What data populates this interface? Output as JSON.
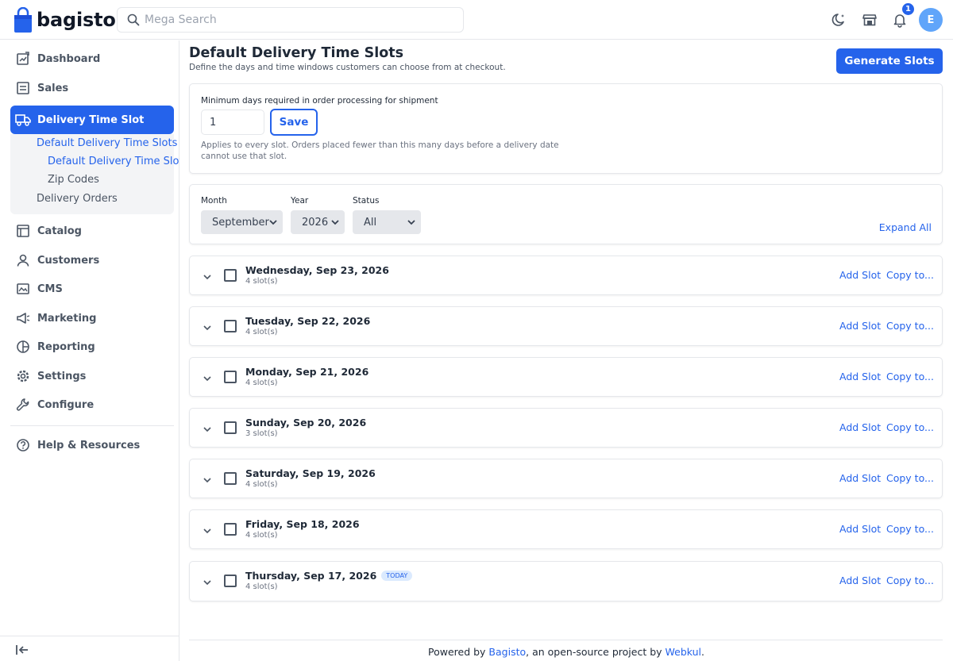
{
  "header": {
    "logo_text": "bagisto",
    "search_placeholder": "Mega Search",
    "notification_count": "1",
    "avatar_initial": "E"
  },
  "sidebar": {
    "items": [
      {
        "label": "Dashboard",
        "icon": "dashboard-icon"
      },
      {
        "label": "Sales",
        "icon": "sales-icon"
      },
      {
        "label": "Delivery Time Slot",
        "icon": "delivery-truck-icon",
        "active": true
      },
      {
        "label": "Catalog",
        "icon": "catalog-icon"
      },
      {
        "label": "Customers",
        "icon": "customers-icon"
      },
      {
        "label": "CMS",
        "icon": "cms-icon"
      },
      {
        "label": "Marketing",
        "icon": "marketing-icon"
      },
      {
        "label": "Reporting",
        "icon": "reporting-icon"
      },
      {
        "label": "Settings",
        "icon": "gear-icon"
      },
      {
        "label": "Configure",
        "icon": "wrench-icon"
      },
      {
        "label": "Help & Resources",
        "icon": "help-icon"
      }
    ],
    "sub_items": [
      {
        "label": "Default Delivery Time Slots",
        "active": true
      },
      {
        "label": "Default Delivery Time Slots",
        "active": true
      },
      {
        "label": "Zip Codes",
        "active": false
      },
      {
        "label": "Delivery Orders",
        "active": false
      }
    ]
  },
  "page": {
    "title": "Default Delivery Time Slots",
    "description": "Define the days and time windows customers can choose from at checkout.",
    "generate_label": "Generate Slots"
  },
  "min_days": {
    "label": "Minimum days required in order processing for shipment",
    "value": "1",
    "save_label": "Save",
    "help": "Applies to every slot. Orders placed fewer than this many days before a delivery date cannot use that slot."
  },
  "filters": {
    "month_label": "Month",
    "month_value": "September",
    "year_label": "Year",
    "year_value": "2026",
    "status_label": "Status",
    "status_value": "All",
    "expand_all": "Expand All"
  },
  "days": [
    {
      "title": "Wednesday, Sep 23, 2026",
      "count": "4 slot(s)"
    },
    {
      "title": "Tuesday, Sep 22, 2026",
      "count": "4 slot(s)"
    },
    {
      "title": "Monday, Sep 21, 2026",
      "count": "4 slot(s)"
    },
    {
      "title": "Sunday, Sep 20, 2026",
      "count": "3 slot(s)"
    },
    {
      "title": "Saturday, Sep 19, 2026",
      "count": "4 slot(s)"
    },
    {
      "title": "Friday, Sep 18, 2026",
      "count": "4 slot(s)"
    },
    {
      "title": "Thursday, Sep 17, 2026",
      "count": "4 slot(s)",
      "badge": "TODAY"
    }
  ],
  "day_actions": {
    "add": "Add Slot",
    "copy": "Copy to..."
  },
  "footer": {
    "prefix": "Powered by ",
    "brand": "Bagisto",
    "middle": ", an open-source project by ",
    "company": "Webkul",
    "suffix": "."
  },
  "colors": {
    "accent": "#2563eb",
    "avatar": "#60a5fa"
  }
}
